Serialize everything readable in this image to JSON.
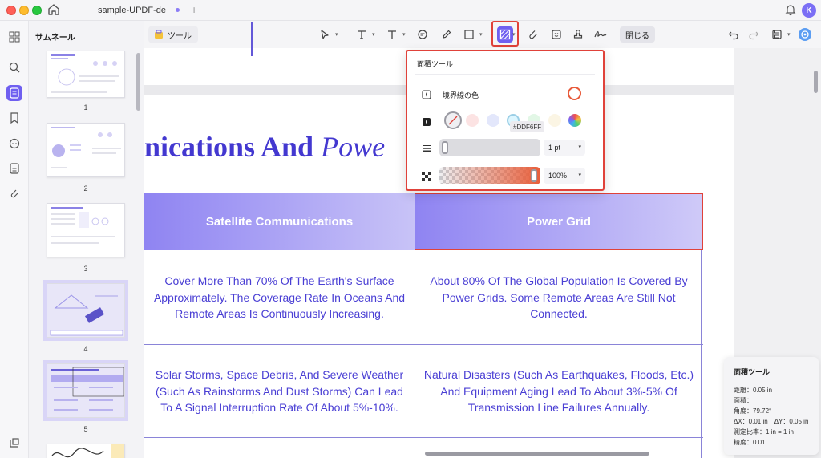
{
  "window": {
    "tab_title": "sample-UPDF-de",
    "new_tab": "+",
    "avatar_letter": "K"
  },
  "sidebar": {
    "title": "サムネール",
    "pages": [
      {
        "number": "1"
      },
      {
        "number": "2"
      },
      {
        "number": "3"
      },
      {
        "number": "4"
      },
      {
        "number": "5"
      }
    ]
  },
  "toolbar": {
    "tool_chip_label": "ツール",
    "close_label": "閉じる",
    "active_tool": "area-tool"
  },
  "document": {
    "heading_bold": "nications And ",
    "heading_italic": "Powe",
    "table": {
      "headers": [
        "Satellite Communications",
        "Power Grid"
      ],
      "rows": [
        [
          "Cover More Than 70% Of The Earth's Surface Approximately. The Coverage Rate In Oceans And Remote Areas Is Continuously Increasing.",
          "About 80% Of The Global Population Is Covered By Power Grids. Some Remote Areas Are Still Not Connected."
        ],
        [
          "Solar Storms, Space Debris, And Severe Weather (Such As Rainstorms And Dust Storms) Can Lead To A Signal Interruption Rate Of About 5%-10%.",
          "Natural Disasters (Such As Earthquakes, Floods, Etc.) And Equipment Aging Lead To About 3%-5% Of Transmission Line Failures Annually."
        ]
      ]
    }
  },
  "area_popover": {
    "title": "面積ツール",
    "border_color_label": "境界線の色",
    "border_color": "#E85A3A",
    "tooltip": "#DDF6FF",
    "fill_swatches": [
      "none",
      "#FCE3E3",
      "#E3E7FB",
      "#DDF6FF",
      "#E2F7E6",
      "#FBF5E4",
      "rainbow"
    ],
    "thickness_value": "1 pt",
    "opacity_value": "100%"
  },
  "info_panel": {
    "title": "面積ツール",
    "lines": [
      "距離：0.05 in",
      "面積：",
      "角度：79.72°",
      "ΔX：0.01 in　ΔY：0.05 in",
      "測定比率：1 in = 1 in",
      "精度：0.01"
    ]
  },
  "colors": {
    "accent": "#6F5FF0",
    "doc_text": "#4A3FD4",
    "highlight_border": "#E0423A"
  }
}
